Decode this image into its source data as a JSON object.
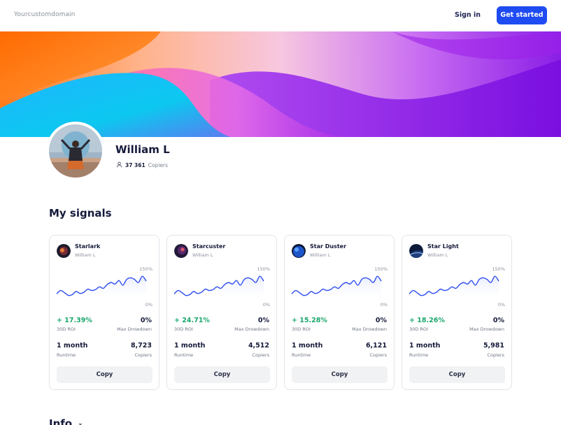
{
  "header": {
    "brand": "Yourcustomdomain",
    "sign_in": "Sign in",
    "get_started": "Get started"
  },
  "profile": {
    "name": "William L",
    "copiers_count": "37 361",
    "copiers_label": "Copiers"
  },
  "signals_title": "My signals",
  "chart_axis": {
    "top": "150%",
    "bottom": "0%"
  },
  "signals": [
    {
      "name": "Starlark",
      "author": "William L",
      "roi": "+ 17.39%",
      "roi_label": "30D ROI",
      "drawdown": "0%",
      "drawdown_label": "Max Drowdown",
      "runtime": "1 month",
      "runtime_label": "Runtime",
      "copiers": "8,723",
      "copiers_label": "Copiers",
      "copy_label": "Copy",
      "icon": "galaxy-red",
      "icon_color": "#7a2a36"
    },
    {
      "name": "Starcuster",
      "author": "William L",
      "roi": "+ 24.71%",
      "roi_label": "30D ROI",
      "drawdown": "0%",
      "drawdown_label": "Max Drowdown",
      "runtime": "1 month",
      "runtime_label": "Runtime",
      "copiers": "4,512",
      "copiers_label": "Copiers",
      "copy_label": "Copy",
      "icon": "galaxy-purple",
      "icon_color": "#5a2a6a"
    },
    {
      "name": "Star Duster",
      "author": "William L",
      "roi": "+ 15.28%",
      "roi_label": "30D ROI",
      "drawdown": "0%",
      "drawdown_label": "Max Drowdown",
      "runtime": "1 month",
      "runtime_label": "Runtime",
      "copiers": "6,121",
      "copiers_label": "Copiers",
      "copy_label": "Copy",
      "icon": "planet-blue",
      "icon_color": "#1d56c9"
    },
    {
      "name": "Star Light",
      "author": "William L",
      "roi": "+ 18.26%",
      "roi_label": "30D ROI",
      "drawdown": "0%",
      "drawdown_label": "Max Drowdown",
      "runtime": "1 month",
      "runtime_label": "Runtime",
      "copiers": "5,981",
      "copiers_label": "Copiers",
      "copy_label": "Copy",
      "icon": "planet-dark",
      "icon_color": "#0c1a3a"
    }
  ],
  "chart_data": {
    "type": "area",
    "series_values": [
      38,
      55,
      44,
      30,
      34,
      50,
      40,
      46,
      62,
      55,
      60,
      74,
      66,
      86,
      96,
      88,
      106,
      82,
      112,
      120,
      112,
      96,
      128,
      103
    ],
    "ylim": [
      0,
      150
    ],
    "tick_labels": [
      "150%",
      "0%"
    ],
    "line_color": "#2e4df0",
    "fill_color": "#e9ecfd"
  },
  "info_title": "Info",
  "colors": {
    "accent": "#1f4bf2",
    "positive": "#19a86b"
  }
}
